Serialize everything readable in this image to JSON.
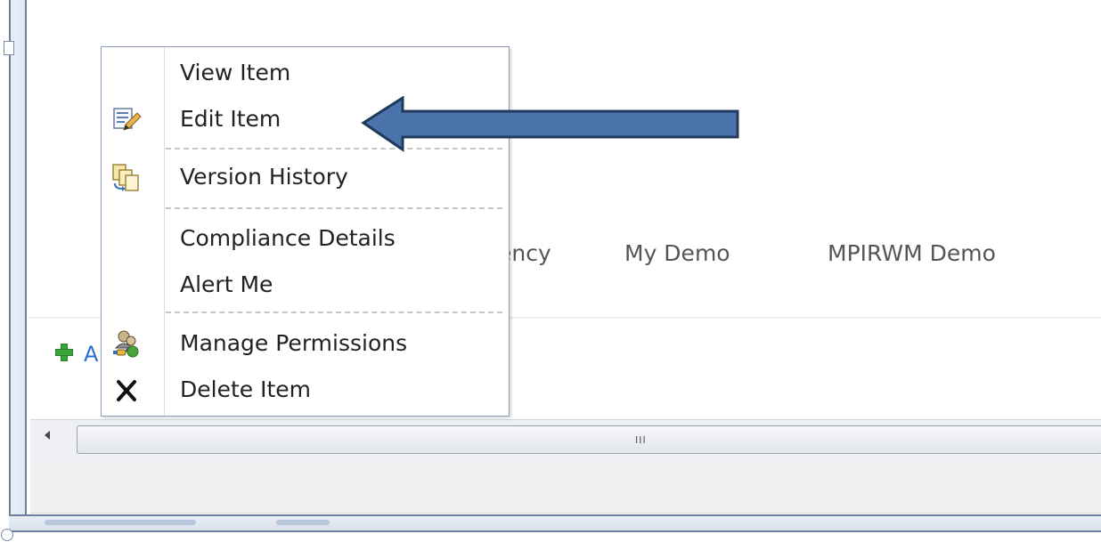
{
  "nav_tabs": {
    "partial": "ency",
    "my_demo": "My Demo",
    "mpirwm_demo": "MPIRWM Demo"
  },
  "add_link_partial": "A",
  "scrollbar": {
    "grip": "III"
  },
  "context_menu": {
    "items": [
      {
        "label": "View Item",
        "icon": ""
      },
      {
        "label": "Edit Item",
        "icon": "edit-item-icon"
      },
      {
        "label": "Version History",
        "icon": "version-history-icon"
      },
      {
        "label": "Compliance Details",
        "icon": ""
      },
      {
        "label": "Alert Me",
        "icon": ""
      },
      {
        "label": "Manage Permissions",
        "icon": "manage-permissions-icon"
      },
      {
        "label": "Delete Item",
        "icon": "delete-x-icon"
      }
    ]
  },
  "colors": {
    "arrow_fill": "#4a74ab",
    "arrow_stroke": "#1f3a5c",
    "menu_border": "#8d9cb8",
    "add_icon": "#3aa43a"
  }
}
